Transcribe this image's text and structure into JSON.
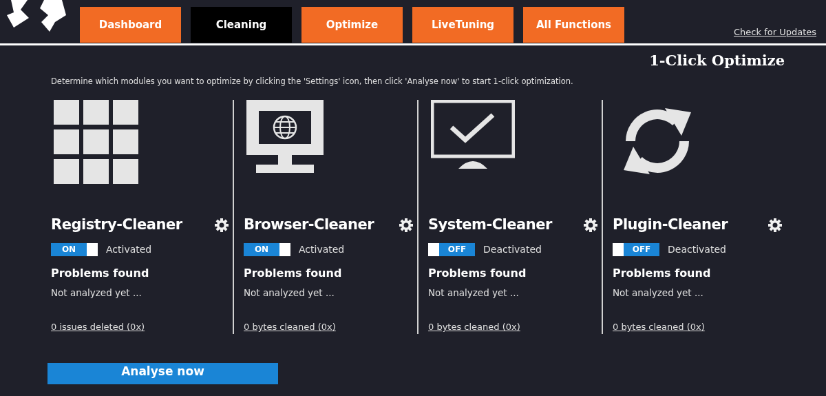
{
  "tabs": [
    {
      "label": "Dashboard",
      "selected": false
    },
    {
      "label": "Cleaning",
      "selected": true
    },
    {
      "label": "Optimize",
      "selected": false
    },
    {
      "label": "LiveTuning",
      "selected": false
    },
    {
      "label": "All Functions",
      "selected": false
    }
  ],
  "update_link": "Check for Updates",
  "title": "1-Click Optimize",
  "description": "Determine which modules you want to optimize by clicking the 'Settings' icon, then click 'Analyse now' to start 1-click optimization.",
  "modules": [
    {
      "kind": "grid",
      "name": "Registry-Cleaner",
      "on": true,
      "switch_label": "ON",
      "status": "Activated",
      "problems_label": "Problems found",
      "problems": "Not analyzed yet ...",
      "link": "0 issues deleted (0x)"
    },
    {
      "kind": "browser",
      "name": "Browser-Cleaner",
      "on": true,
      "switch_label": "ON",
      "status": "Activated",
      "problems_label": "Problems found",
      "problems": "Not analyzed yet ...",
      "link": "0 bytes cleaned (0x)"
    },
    {
      "kind": "system",
      "name": "System-Cleaner",
      "on": false,
      "switch_label": "OFF",
      "status": "Deactivated",
      "problems_label": "Problems found",
      "problems": "Not analyzed yet ...",
      "link": "0 bytes cleaned (0x)"
    },
    {
      "kind": "plugin",
      "name": "Plugin-Cleaner",
      "on": false,
      "switch_label": "OFF",
      "status": "Deactivated",
      "problems_label": "Problems found",
      "problems": "Not analyzed yet ...",
      "link": "0 bytes cleaned (0x)"
    }
  ],
  "analyse_button": "Analyse now"
}
